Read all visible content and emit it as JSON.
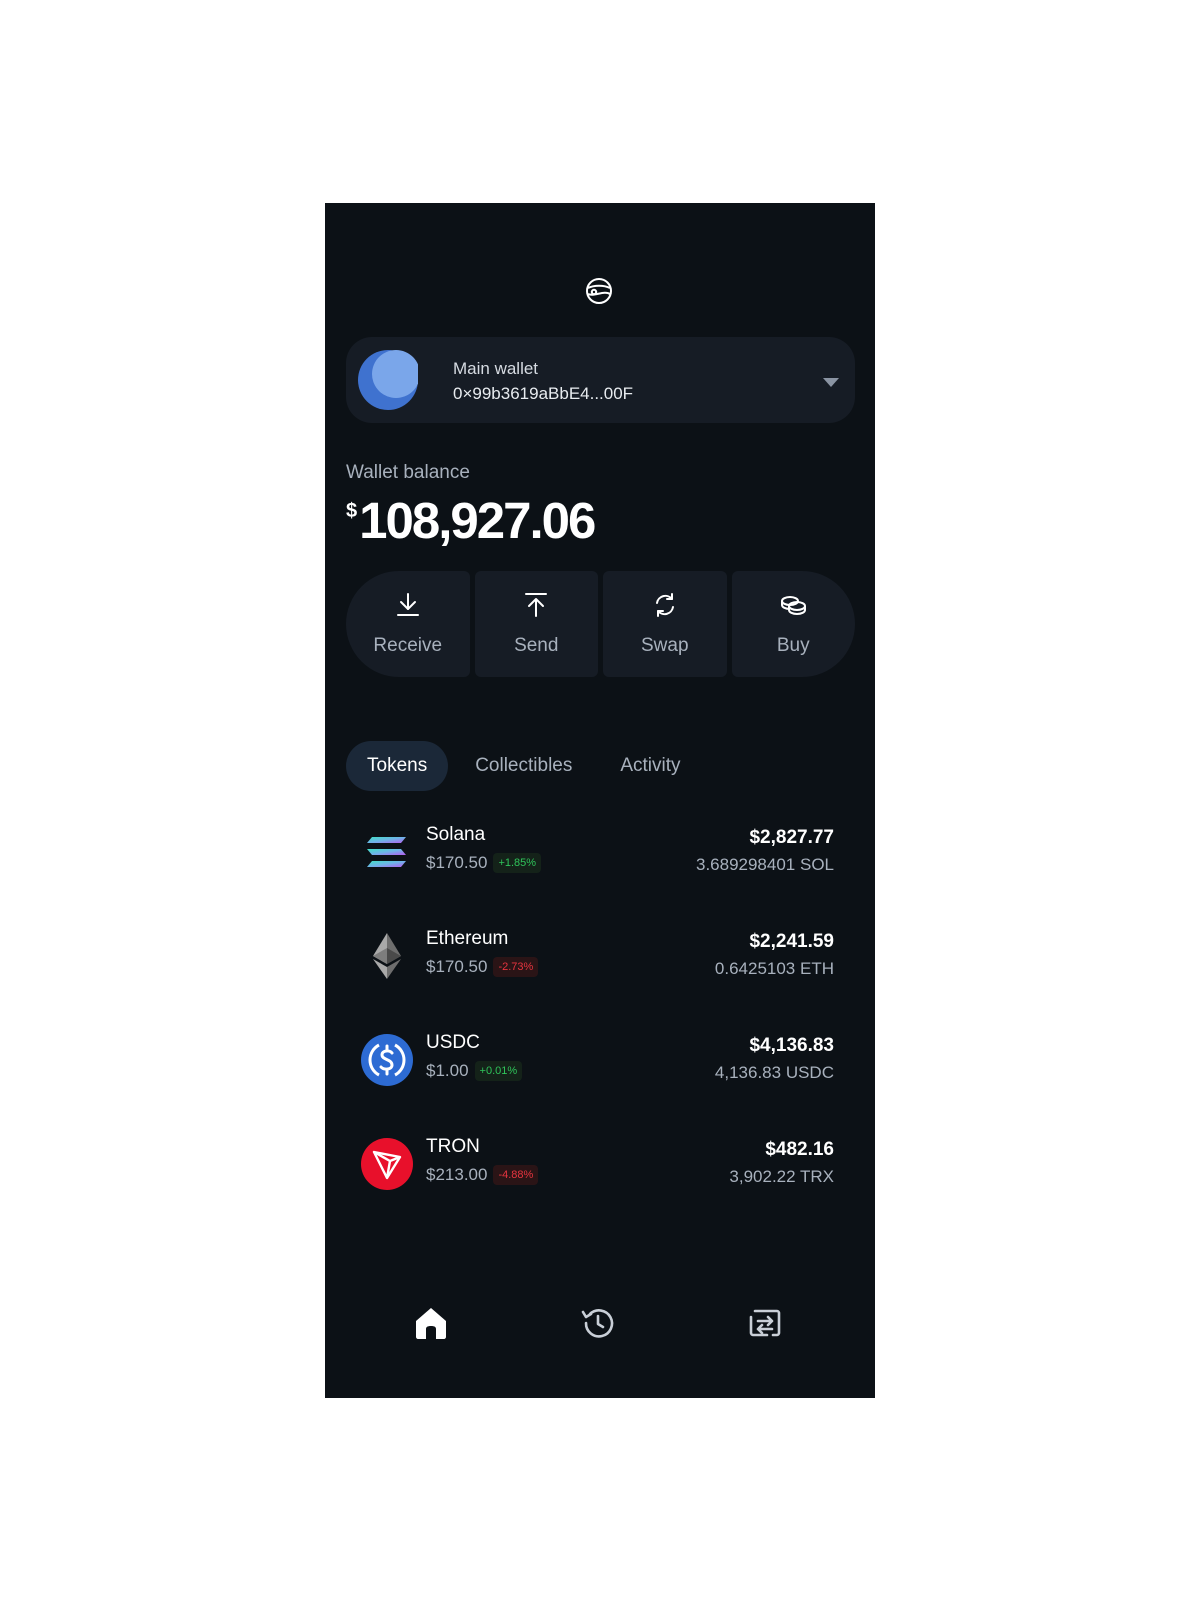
{
  "header": {
    "logo_icon": "planet-logo-icon"
  },
  "wallet": {
    "name": "Main wallet",
    "address": "0×99b3619aBbE4...00F",
    "avatar_color": "#4a7fd6",
    "caret_icon": "chevron-down-icon"
  },
  "balance": {
    "label": "Wallet balance",
    "currency": "$",
    "amount": "108,927.06"
  },
  "actions": [
    {
      "label": "Receive",
      "icon": "download-icon"
    },
    {
      "label": "Send",
      "icon": "upload-icon"
    },
    {
      "label": "Swap",
      "icon": "refresh-icon"
    },
    {
      "label": "Buy",
      "icon": "coins-icon"
    }
  ],
  "tabs": [
    {
      "label": "Tokens",
      "active": true
    },
    {
      "label": "Collectibles",
      "active": false
    },
    {
      "label": "Activity",
      "active": false
    }
  ],
  "tokens": [
    {
      "name": "Solana",
      "price": "$170.50",
      "change": "+1.85%",
      "direction": "up",
      "value": "$2,827.77",
      "amount": "3.689298401 SOL",
      "icon": "solana-icon"
    },
    {
      "name": "Ethereum",
      "price": "$170.50",
      "change": "-2.73%",
      "direction": "down",
      "value": "$2,241.59",
      "amount": "0.6425103 ETH",
      "icon": "ethereum-icon"
    },
    {
      "name": "USDC",
      "price": "$1.00",
      "change": "+0.01%",
      "direction": "up",
      "value": "$4,136.83",
      "amount": "4,136.83 USDC",
      "icon": "usdc-icon"
    },
    {
      "name": "TRON",
      "price": "$213.00",
      "change": "-4.88%",
      "direction": "down",
      "value": "$482.16",
      "amount": "3,902.22 TRX",
      "icon": "tron-icon"
    }
  ],
  "bottom_nav": [
    {
      "icon": "home-icon",
      "active": true
    },
    {
      "icon": "history-icon",
      "active": false
    },
    {
      "icon": "transfer-icon",
      "active": false
    }
  ],
  "colors": {
    "background": "#0c1116",
    "card": "#161c25",
    "active_tab": "#1b2838",
    "positive": "#2fc35a",
    "negative": "#e6343f"
  }
}
